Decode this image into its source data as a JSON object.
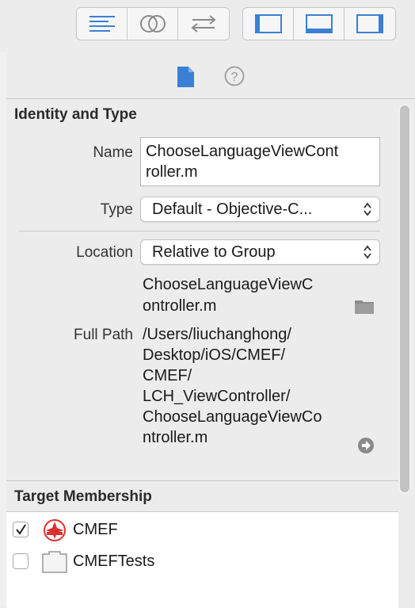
{
  "toolbar": {
    "editor_icons": [
      "standard-editor-icon",
      "assistant-editor-icon",
      "version-editor-icon"
    ],
    "view_icons": [
      "navigator-toggle-icon",
      "debug-area-toggle-icon",
      "utilities-toggle-icon"
    ]
  },
  "inspector_tabs": [
    "file-inspector-icon",
    "quick-help-icon"
  ],
  "identity": {
    "title": "Identity and Type",
    "name_label": "Name",
    "name_value_line1": "ChooseLanguageViewCont",
    "name_value_line2": "roller.m",
    "type_label": "Type",
    "type_value": "Default - Objective-C...",
    "location_label": "Location",
    "location_value": "Relative to Group",
    "relative_path_line1": "ChooseLanguageViewC",
    "relative_path_line2": "ontroller.m",
    "full_path_label": "Full Path",
    "full_path_lines": [
      "/Users/liuchanghong/",
      "Desktop/iOS/CMEF/",
      "CMEF/",
      "LCH_ViewController/",
      "ChooseLanguageViewCo",
      "ntroller.m"
    ]
  },
  "target_membership": {
    "title": "Target Membership",
    "targets": [
      {
        "name": "CMEF",
        "checked": true
      },
      {
        "name": "CMEFTests",
        "checked": false
      }
    ]
  },
  "colors": {
    "accent": "#3b80d4",
    "app_icon_red": "#d8322e"
  }
}
